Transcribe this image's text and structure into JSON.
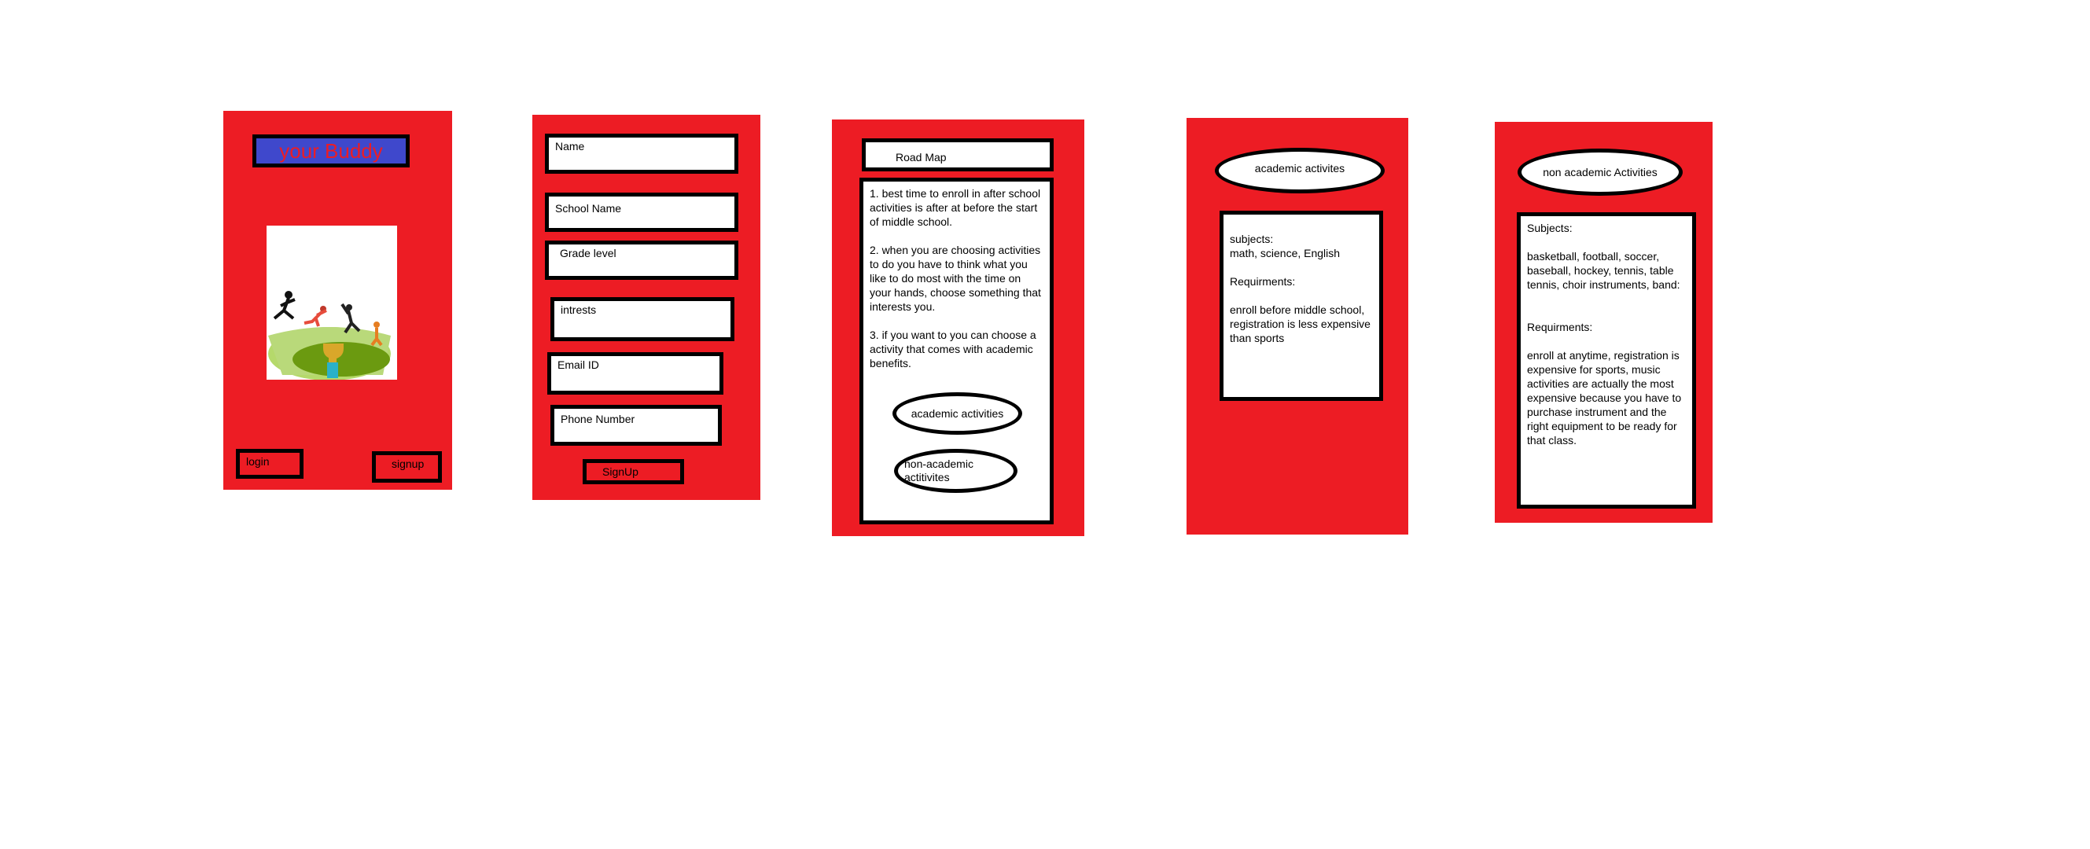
{
  "screen1": {
    "title": "your Buddy",
    "login_label": "login",
    "signup_label": "signup"
  },
  "screen2": {
    "fields": [
      "Name",
      "School Name",
      "Grade level",
      "intrests",
      "Email ID",
      "Phone Number"
    ],
    "signup_button": "SignUp"
  },
  "screen3": {
    "header": "Road Map",
    "tips": "1. best time to enroll in after school activities is after at before the start of middle school.\n\n2. when you are choosing activities to do you have to think what you like to do most with the time on your hands, choose something that interests you.\n\n3. if you want to you can choose a activity that comes with academic benefits.",
    "academic_button": "academic activities",
    "non_academic_button": "non-academic actitivites"
  },
  "screen4": {
    "header": "academic activites",
    "content": "subjects:\nmath, science, English\n\nRequirments:\n\n enroll before middle school, registration is less expensive than sports"
  },
  "screen5": {
    "header": "non academic Activities",
    "content": "Subjects:\n\nbasketball, football, soccer, baseball, hockey, tennis, table tennis, choir instruments, band:\n\n\nRequirments:\n\nenroll at anytime, registration is expensive for sports, music activities are actually the most expensive because you have to purchase instrument and the right equipment to be ready for that class."
  },
  "colors": {
    "panel": "#ed1c24",
    "title_bg": "#3f48cc",
    "title_text": "#ed1c24"
  },
  "icons": [
    "sports-illustration"
  ]
}
